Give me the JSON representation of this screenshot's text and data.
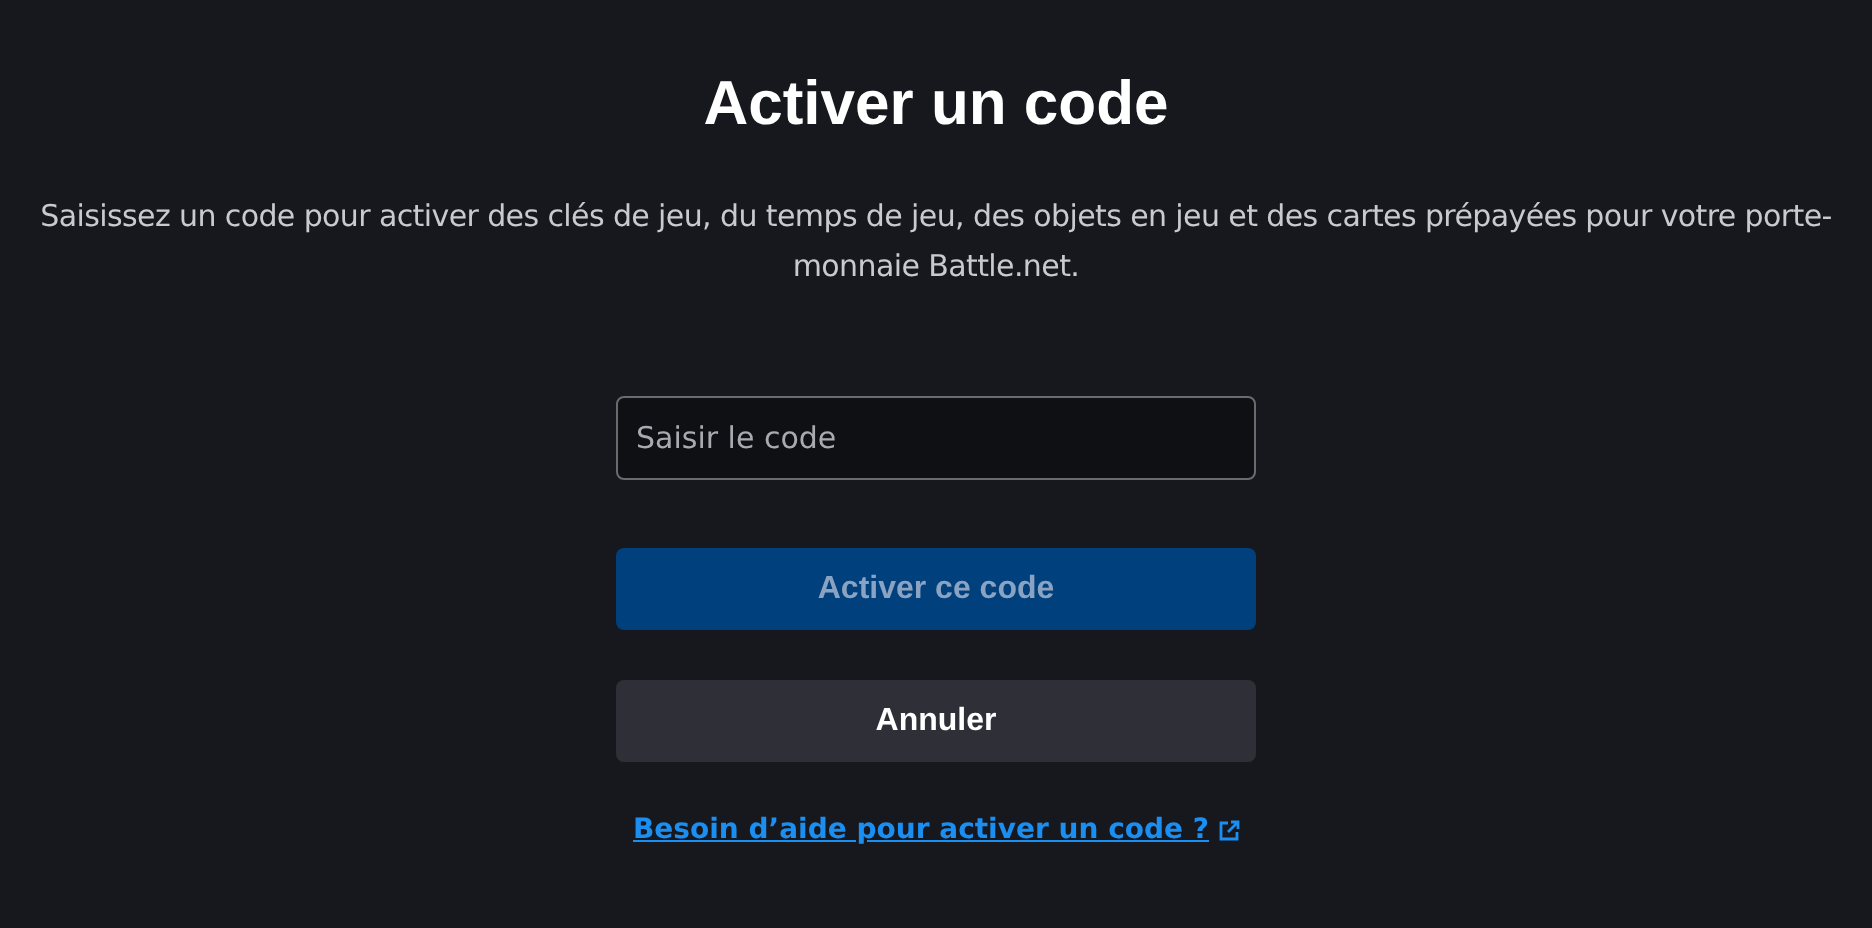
{
  "title": "Activer un code",
  "description": "Saisissez un code pour activer des clés de jeu, du temps de jeu, des objets en jeu et des cartes prépayées pour votre porte-monnaie Battle.net.",
  "code_field": {
    "placeholder": "Saisir le code"
  },
  "activate_button": {
    "label": "Activer ce code",
    "disabled": true
  },
  "cancel_button": {
    "label": "Annuler"
  },
  "help_link": {
    "label": "Besoin d’aide pour activer un code ?"
  }
}
